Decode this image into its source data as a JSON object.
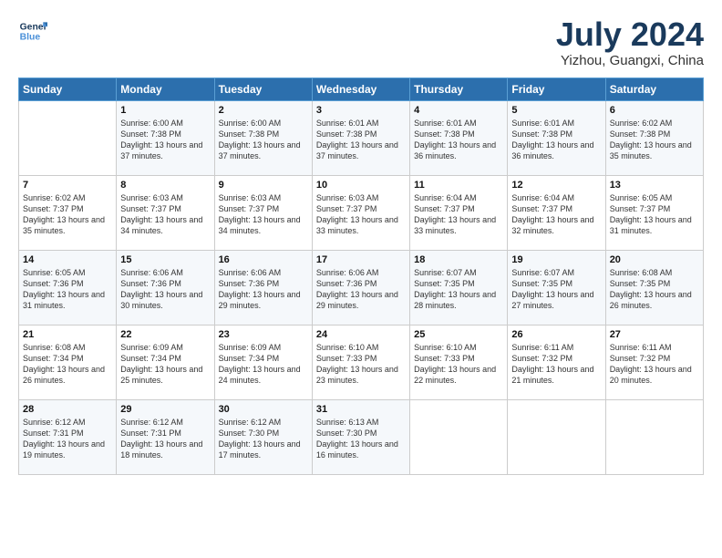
{
  "logo": {
    "line1": "General",
    "line2": "Blue"
  },
  "title": "July 2024",
  "subtitle": "Yizhou, Guangxi, China",
  "header_days": [
    "Sunday",
    "Monday",
    "Tuesday",
    "Wednesday",
    "Thursday",
    "Friday",
    "Saturday"
  ],
  "weeks": [
    [
      {
        "day": "",
        "sunrise": "",
        "sunset": "",
        "daylight": ""
      },
      {
        "day": "1",
        "sunrise": "Sunrise: 6:00 AM",
        "sunset": "Sunset: 7:38 PM",
        "daylight": "Daylight: 13 hours and 37 minutes."
      },
      {
        "day": "2",
        "sunrise": "Sunrise: 6:00 AM",
        "sunset": "Sunset: 7:38 PM",
        "daylight": "Daylight: 13 hours and 37 minutes."
      },
      {
        "day": "3",
        "sunrise": "Sunrise: 6:01 AM",
        "sunset": "Sunset: 7:38 PM",
        "daylight": "Daylight: 13 hours and 37 minutes."
      },
      {
        "day": "4",
        "sunrise": "Sunrise: 6:01 AM",
        "sunset": "Sunset: 7:38 PM",
        "daylight": "Daylight: 13 hours and 36 minutes."
      },
      {
        "day": "5",
        "sunrise": "Sunrise: 6:01 AM",
        "sunset": "Sunset: 7:38 PM",
        "daylight": "Daylight: 13 hours and 36 minutes."
      },
      {
        "day": "6",
        "sunrise": "Sunrise: 6:02 AM",
        "sunset": "Sunset: 7:38 PM",
        "daylight": "Daylight: 13 hours and 35 minutes."
      }
    ],
    [
      {
        "day": "7",
        "sunrise": "Sunrise: 6:02 AM",
        "sunset": "Sunset: 7:37 PM",
        "daylight": "Daylight: 13 hours and 35 minutes."
      },
      {
        "day": "8",
        "sunrise": "Sunrise: 6:03 AM",
        "sunset": "Sunset: 7:37 PM",
        "daylight": "Daylight: 13 hours and 34 minutes."
      },
      {
        "day": "9",
        "sunrise": "Sunrise: 6:03 AM",
        "sunset": "Sunset: 7:37 PM",
        "daylight": "Daylight: 13 hours and 34 minutes."
      },
      {
        "day": "10",
        "sunrise": "Sunrise: 6:03 AM",
        "sunset": "Sunset: 7:37 PM",
        "daylight": "Daylight: 13 hours and 33 minutes."
      },
      {
        "day": "11",
        "sunrise": "Sunrise: 6:04 AM",
        "sunset": "Sunset: 7:37 PM",
        "daylight": "Daylight: 13 hours and 33 minutes."
      },
      {
        "day": "12",
        "sunrise": "Sunrise: 6:04 AM",
        "sunset": "Sunset: 7:37 PM",
        "daylight": "Daylight: 13 hours and 32 minutes."
      },
      {
        "day": "13",
        "sunrise": "Sunrise: 6:05 AM",
        "sunset": "Sunset: 7:37 PM",
        "daylight": "Daylight: 13 hours and 31 minutes."
      }
    ],
    [
      {
        "day": "14",
        "sunrise": "Sunrise: 6:05 AM",
        "sunset": "Sunset: 7:36 PM",
        "daylight": "Daylight: 13 hours and 31 minutes."
      },
      {
        "day": "15",
        "sunrise": "Sunrise: 6:06 AM",
        "sunset": "Sunset: 7:36 PM",
        "daylight": "Daylight: 13 hours and 30 minutes."
      },
      {
        "day": "16",
        "sunrise": "Sunrise: 6:06 AM",
        "sunset": "Sunset: 7:36 PM",
        "daylight": "Daylight: 13 hours and 29 minutes."
      },
      {
        "day": "17",
        "sunrise": "Sunrise: 6:06 AM",
        "sunset": "Sunset: 7:36 PM",
        "daylight": "Daylight: 13 hours and 29 minutes."
      },
      {
        "day": "18",
        "sunrise": "Sunrise: 6:07 AM",
        "sunset": "Sunset: 7:35 PM",
        "daylight": "Daylight: 13 hours and 28 minutes."
      },
      {
        "day": "19",
        "sunrise": "Sunrise: 6:07 AM",
        "sunset": "Sunset: 7:35 PM",
        "daylight": "Daylight: 13 hours and 27 minutes."
      },
      {
        "day": "20",
        "sunrise": "Sunrise: 6:08 AM",
        "sunset": "Sunset: 7:35 PM",
        "daylight": "Daylight: 13 hours and 26 minutes."
      }
    ],
    [
      {
        "day": "21",
        "sunrise": "Sunrise: 6:08 AM",
        "sunset": "Sunset: 7:34 PM",
        "daylight": "Daylight: 13 hours and 26 minutes."
      },
      {
        "day": "22",
        "sunrise": "Sunrise: 6:09 AM",
        "sunset": "Sunset: 7:34 PM",
        "daylight": "Daylight: 13 hours and 25 minutes."
      },
      {
        "day": "23",
        "sunrise": "Sunrise: 6:09 AM",
        "sunset": "Sunset: 7:34 PM",
        "daylight": "Daylight: 13 hours and 24 minutes."
      },
      {
        "day": "24",
        "sunrise": "Sunrise: 6:10 AM",
        "sunset": "Sunset: 7:33 PM",
        "daylight": "Daylight: 13 hours and 23 minutes."
      },
      {
        "day": "25",
        "sunrise": "Sunrise: 6:10 AM",
        "sunset": "Sunset: 7:33 PM",
        "daylight": "Daylight: 13 hours and 22 minutes."
      },
      {
        "day": "26",
        "sunrise": "Sunrise: 6:11 AM",
        "sunset": "Sunset: 7:32 PM",
        "daylight": "Daylight: 13 hours and 21 minutes."
      },
      {
        "day": "27",
        "sunrise": "Sunrise: 6:11 AM",
        "sunset": "Sunset: 7:32 PM",
        "daylight": "Daylight: 13 hours and 20 minutes."
      }
    ],
    [
      {
        "day": "28",
        "sunrise": "Sunrise: 6:12 AM",
        "sunset": "Sunset: 7:31 PM",
        "daylight": "Daylight: 13 hours and 19 minutes."
      },
      {
        "day": "29",
        "sunrise": "Sunrise: 6:12 AM",
        "sunset": "Sunset: 7:31 PM",
        "daylight": "Daylight: 13 hours and 18 minutes."
      },
      {
        "day": "30",
        "sunrise": "Sunrise: 6:12 AM",
        "sunset": "Sunset: 7:30 PM",
        "daylight": "Daylight: 13 hours and 17 minutes."
      },
      {
        "day": "31",
        "sunrise": "Sunrise: 6:13 AM",
        "sunset": "Sunset: 7:30 PM",
        "daylight": "Daylight: 13 hours and 16 minutes."
      },
      {
        "day": "",
        "sunrise": "",
        "sunset": "",
        "daylight": ""
      },
      {
        "day": "",
        "sunrise": "",
        "sunset": "",
        "daylight": ""
      },
      {
        "day": "",
        "sunrise": "",
        "sunset": "",
        "daylight": ""
      }
    ]
  ]
}
